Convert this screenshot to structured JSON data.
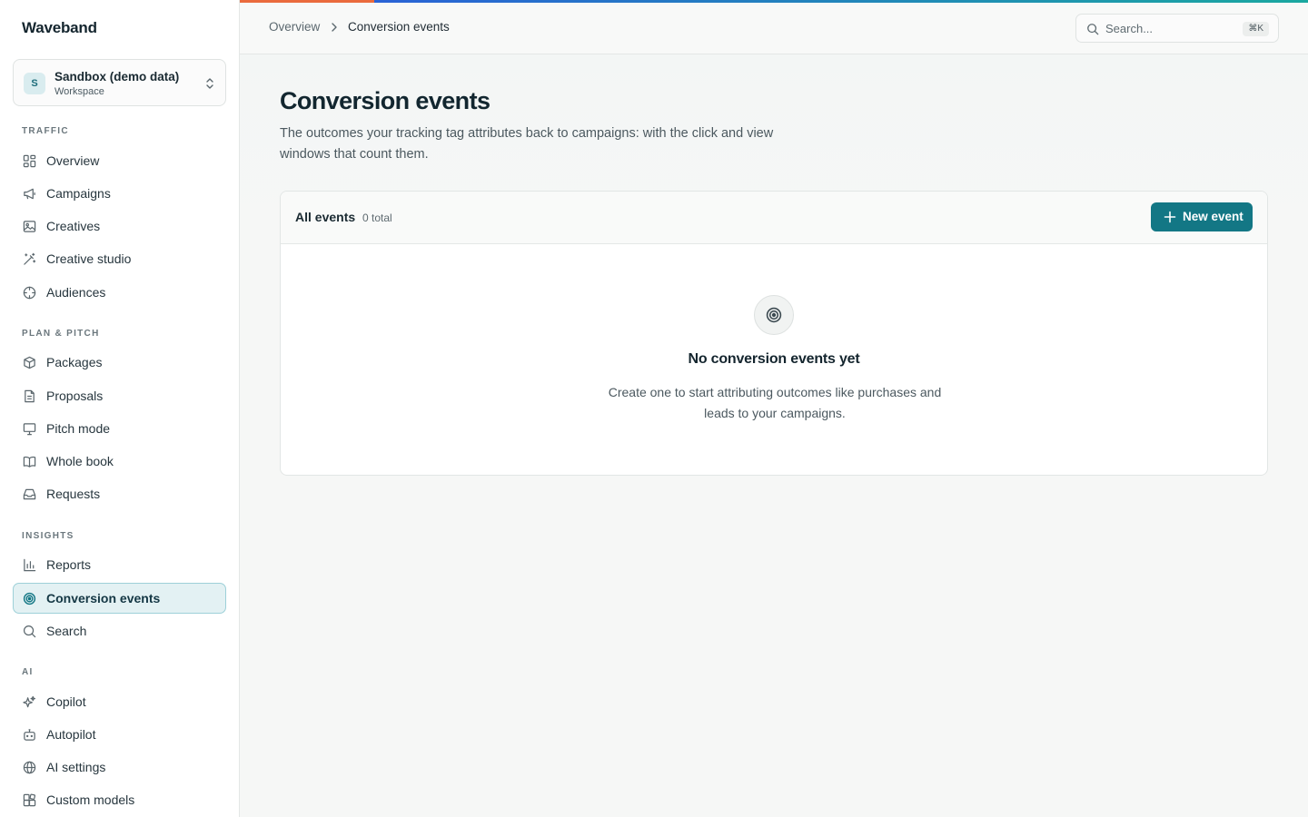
{
  "brand": "Waveband",
  "workspace": {
    "avatar": "S",
    "name": "Sandbox (demo data)",
    "type": "Workspace"
  },
  "sections": [
    {
      "label": "TRAFFIC",
      "items": [
        "Overview",
        "Campaigns",
        "Creatives",
        "Creative studio",
        "Audiences"
      ]
    },
    {
      "label": "PLAN & PITCH",
      "items": [
        "Packages",
        "Proposals",
        "Pitch mode",
        "Whole book",
        "Requests"
      ]
    },
    {
      "label": "INSIGHTS",
      "items": [
        "Reports",
        "Conversion events",
        "Search"
      ]
    },
    {
      "label": "AI",
      "items": [
        "Copilot",
        "Autopilot",
        "AI settings",
        "Custom models"
      ]
    }
  ],
  "breadcrumb": {
    "parent": "Overview",
    "current": "Conversion events"
  },
  "search": {
    "placeholder": "Search...",
    "shortcut": "⌘K"
  },
  "page": {
    "title": "Conversion events",
    "description": "The outcomes your tracking tag attributes back to campaigns: with the click and view windows that count them."
  },
  "card": {
    "title": "All events",
    "count": "0 total",
    "new_button": "New event",
    "empty_title": "No conversion events yet",
    "empty_desc": "Create one to start attributing outcomes like purchases and leads to your campaigns."
  },
  "colors": {
    "accent": "#137785",
    "active_bg": "#e3f1f3",
    "active_border": "#9dd0d8"
  }
}
